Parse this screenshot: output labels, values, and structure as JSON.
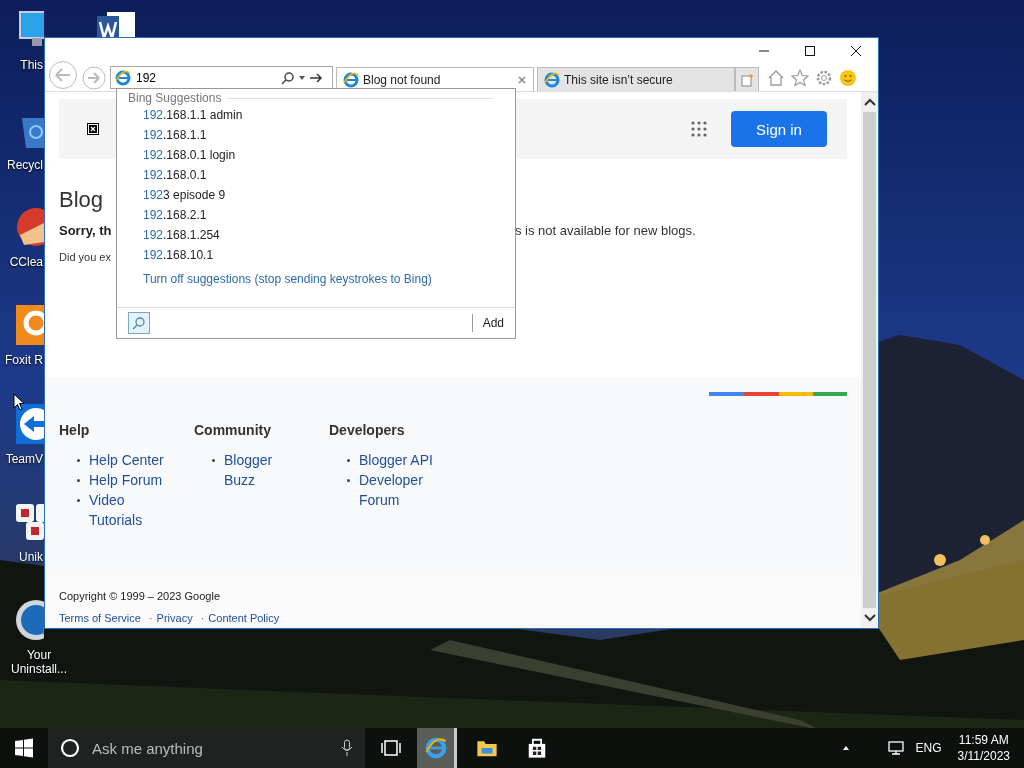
{
  "desktop": {
    "icons": [
      {
        "kind": "pc",
        "label": "This"
      },
      {
        "kind": "word"
      },
      {
        "kind": "recycle",
        "label": "Recycl"
      },
      {
        "kind": "ccleaner",
        "label": "CClea"
      },
      {
        "kind": "foxit",
        "label": "Foxit R"
      },
      {
        "kind": "teamviewer",
        "label": "TeamV"
      },
      {
        "kind": "unikey",
        "label": "Unik"
      },
      {
        "kind": "uninstaller",
        "label": "Your Uninstall..."
      }
    ]
  },
  "browser": {
    "address": {
      "value": "192"
    },
    "tabs": [
      {
        "title": "Blog not found",
        "selected": true
      },
      {
        "title": "This site isn’t secure",
        "selected": false
      }
    ],
    "page": {
      "sign_in": "Sign in",
      "heading": "Blog",
      "message_left": "Sorry, th",
      "message_right": "s is not available for new blogs.",
      "hint": "Did you ex",
      "footer_columns": [
        {
          "heading": "Help",
          "links": [
            "Help Center",
            "Help Forum",
            "Video Tutorials"
          ]
        },
        {
          "heading": "Community",
          "links": [
            "Blogger Buzz"
          ]
        },
        {
          "heading": "Developers",
          "links": [
            "Blogger API",
            "Developer Forum"
          ]
        }
      ],
      "copyright": "Copyright © 1999 – 2023 Google",
      "legal_links": [
        "Terms of Service",
        "Privacy",
        "Content Policy"
      ],
      "separator": "·"
    },
    "suggestions": {
      "header": "Bing Suggestions",
      "items": [
        {
          "match": "192",
          "rest": ".168.1.1 admin"
        },
        {
          "match": "192",
          "rest": ".168.1.1"
        },
        {
          "match": "192",
          "rest": ".168.0.1 login"
        },
        {
          "match": "192",
          "rest": ".168.0.1"
        },
        {
          "match": "192",
          "rest": "3 episode 9"
        },
        {
          "match": "192",
          "rest": ".168.2.1"
        },
        {
          "match": "192",
          "rest": ".168.1.254"
        },
        {
          "match": "192",
          "rest": ".168.10.1"
        }
      ],
      "turn_off": "Turn off suggestions (stop sending keystrokes to Bing)",
      "add": "Add"
    }
  },
  "taskbar": {
    "search_placeholder": "Ask me anything",
    "apps": [
      {
        "kind": "ie",
        "selected": true
      },
      {
        "kind": "folder",
        "selected": false
      },
      {
        "kind": "store",
        "selected": false
      }
    ],
    "language": "ENG",
    "time": "11:59 AM",
    "date": "3/11/2023"
  }
}
